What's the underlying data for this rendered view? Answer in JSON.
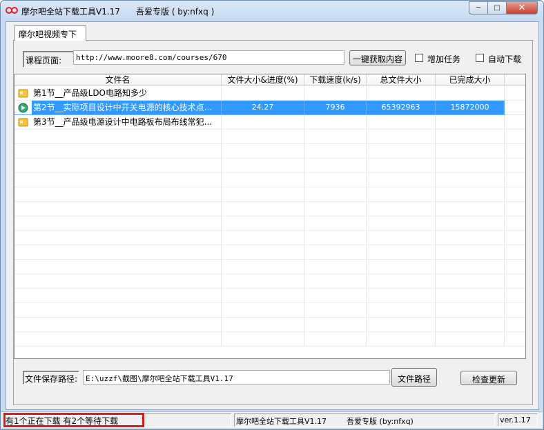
{
  "window": {
    "title": "摩尔吧全站下载工具V1.17",
    "subtitle": "吾爱专版 ( by:nfxq )",
    "controls": {
      "minimize": "─",
      "maximize": "□",
      "close": "✕"
    },
    "icon": "infinity-logo-icon"
  },
  "tabs": [
    {
      "label": "摩尔吧视频专下"
    }
  ],
  "url_bar": {
    "label": "课程页面:",
    "value": "http://www.moore8.com/courses/670",
    "fetch_button": "一键获取内容",
    "add_task_label": "增加任务",
    "auto_download_label": "自动下载"
  },
  "table": {
    "columns": [
      "文件名",
      "文件大小&进度(%)",
      "下载速度(k/s)",
      "总文件大小",
      "已完成大小"
    ],
    "rows": [
      {
        "name": "第1节__产品级LDO电路知多少",
        "progress": "",
        "speed": "",
        "total": "",
        "done": "",
        "icon": "folder-icon",
        "selected": false
      },
      {
        "name": "第2节__实际项目设计中开关电源的核心技术点...",
        "progress": "24.27",
        "speed": "7936",
        "total": "65392963",
        "done": "15872000",
        "icon": "downloading-icon",
        "selected": true
      },
      {
        "name": "第3节__产品级电源设计中电路板布局布线常犯...",
        "progress": "",
        "speed": "",
        "total": "",
        "done": "",
        "icon": "folder-icon",
        "selected": false
      }
    ]
  },
  "save_path": {
    "label": "文件保存路径:",
    "value": "E:\\uzzf\\截图\\摩尔吧全站下载工具V1.17",
    "browse_button": "文件路径",
    "update_button": "检查更新"
  },
  "statusbar": {
    "status": "有1个正在下载  有2个等待下载",
    "app_name": "摩尔吧全站下载工具V1.17",
    "edition": "吾爱专版 (by:nfxq)",
    "version": "ver.1.17"
  },
  "colors": {
    "selection": "#3399ff",
    "highlight_border": "#d71c1c",
    "titlebar": "#c5d9f1"
  }
}
